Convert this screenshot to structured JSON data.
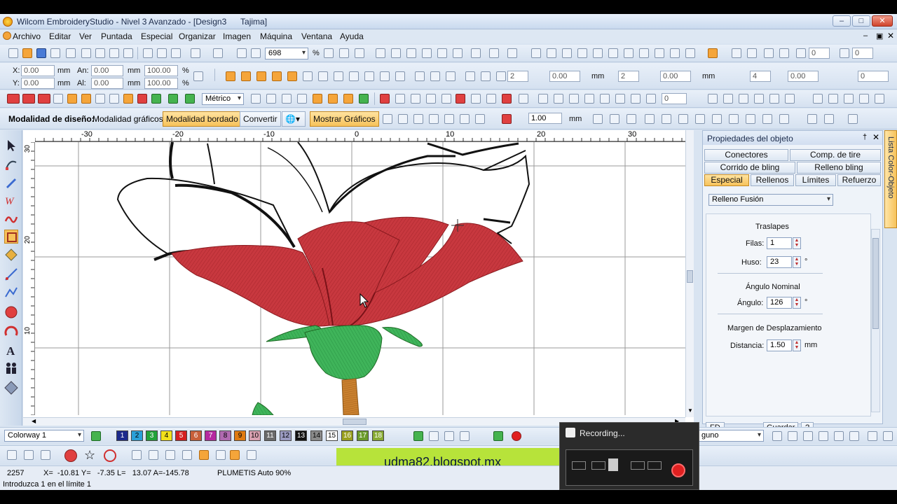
{
  "window": {
    "title": "Wilcom EmbroideryStudio - Nivel 3 Avanzado - [Design3      Tajima]"
  },
  "menu": [
    "Archivo",
    "Editar",
    "Ver",
    "Puntada",
    "Especial",
    "Organizar",
    "Imagen",
    "Máquina",
    "Ventana",
    "Ayuda"
  ],
  "toolbar1": {
    "zoom_value": "698",
    "zoom_unit": "%",
    "rotate_value": "0",
    "rotate_value2": "0"
  },
  "toolbar2": {
    "x_label": "X:",
    "x_value": "0.00",
    "x_unit": "mm",
    "y_label": "Y:",
    "y_value": "0.00",
    "y_unit": "mm",
    "w_label": "An:",
    "w_value": "0.00",
    "w_unit": "mm",
    "w_pct": "100.00",
    "w_pct_unit": "%",
    "h_label": "Al:",
    "h_value": "0.00",
    "h_unit": "mm",
    "h_pct": "100.00",
    "h_pct_unit": "%",
    "count1": "2",
    "val1": "0.00",
    "unit1": "mm",
    "count2": "2",
    "val2": "0.00",
    "unit2": "mm",
    "count3": "4",
    "val3": "0.00",
    "val4": "0"
  },
  "toolbar3": {
    "units": "Métrico",
    "val": "0"
  },
  "toolbar4": {
    "mode_label": "Modalidad de diseño:",
    "graphics_mode": "Modalidad gráficos",
    "embroidery_mode": "Modalidad bordado",
    "convert": "Convertir",
    "show_graphics": "Mostrar Gráficos",
    "size_value": "1.00",
    "size_unit": "mm"
  },
  "rulers": {
    "h_ticks": [
      "-30",
      "-20",
      "-10",
      "0",
      "10",
      "20",
      "30"
    ],
    "v_ticks": [
      "30",
      "20",
      "10"
    ]
  },
  "properties": {
    "title": "Propiedades del objeto",
    "tabs_row1": [
      "Conectores",
      "Comp. de tire"
    ],
    "tabs_row2": [
      "Corrido de bling",
      "Relleno bling"
    ],
    "tabs_row3": [
      "Especial",
      "Rellenos",
      "Límites",
      "Refuerzo"
    ],
    "fill_type": "Relleno Fusión",
    "overlaps_title": "Traslapes",
    "rows_label": "Filas:",
    "rows_value": "1",
    "spindle_label": "Huso:",
    "spindle_value": "23",
    "spindle_unit": "°",
    "nominal_title": "Ángulo Nominal",
    "angle_label": "Ángulo:",
    "angle_value": "126",
    "angle_unit": "°",
    "offset_title": "Margen de Desplazamiento",
    "distance_label": "Distancia:",
    "distance_value": "1.50",
    "distance_unit": "mm",
    "fd_button": "FD",
    "save_button": "Guardar",
    "help_button": "?"
  },
  "side_tab": "Lista Color-Objeto",
  "palette": {
    "colorway": "Colorway 1",
    "right_dropdown": "guno",
    "swatches": [
      {
        "n": "1",
        "color": "#1c2a8c"
      },
      {
        "n": "2",
        "color": "#2aa0d8"
      },
      {
        "n": "3",
        "color": "#23a23a"
      },
      {
        "n": "4",
        "color": "#f2e11a"
      },
      {
        "n": "5",
        "color": "#d42020"
      },
      {
        "n": "6",
        "color": "#c8603a"
      },
      {
        "n": "7",
        "color": "#b52aa0"
      },
      {
        "n": "8",
        "color": "#b06ab0"
      },
      {
        "n": "9",
        "color": "#e07a10"
      },
      {
        "n": "10",
        "color": "#d8a0b0"
      },
      {
        "n": "11",
        "color": "#6a6a6a"
      },
      {
        "n": "12",
        "color": "#9a9ac0"
      },
      {
        "n": "13",
        "color": "#111111"
      },
      {
        "n": "14",
        "color": "#8a8a8a"
      },
      {
        "n": "15",
        "color": "#ffffff"
      },
      {
        "n": "16",
        "color": "#9aa020"
      },
      {
        "n": "17",
        "color": "#6a9a2a"
      },
      {
        "n": "18",
        "color": "#88aa33"
      }
    ]
  },
  "banner": "udma82.blogspot.mx",
  "recording": {
    "title": "Recording..."
  },
  "status": {
    "count": "2257",
    "coords": "X=  -10.81 Y=   -7.35 L=   13.07 A=-145.78",
    "stitch": "PLUMETIS Auto 90%",
    "prompt": "Introduzca 1 en el límite 1"
  },
  "colors": {
    "rose_red": "#c8383f",
    "leaf_green": "#3fb45a",
    "stem_orange": "#c9802f",
    "accent_orange": "#f7c25a"
  }
}
